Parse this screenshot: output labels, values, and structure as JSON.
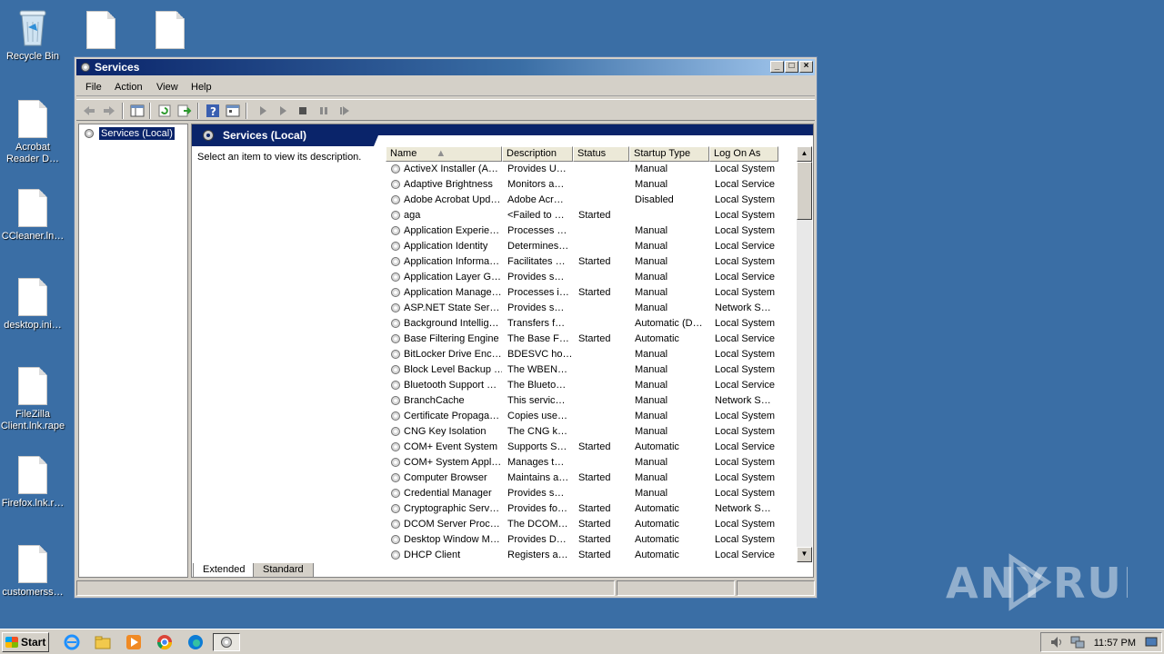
{
  "desktop": {
    "icons": [
      {
        "label": "Recycle Bin"
      },
      {
        "label": "Acrobat Reader D…"
      },
      {
        "label": "CCleaner.ln…"
      },
      {
        "label": "desktop.ini…"
      },
      {
        "label": "FileZilla Client.lnk.rape"
      },
      {
        "label": "Firefox.lnk.r…"
      },
      {
        "label": "customerss…"
      }
    ]
  },
  "window": {
    "title": "Services",
    "menu": [
      "File",
      "Action",
      "View",
      "Help"
    ],
    "tree": {
      "selected": "Services (Local)"
    },
    "header": {
      "title": "Services (Local)"
    },
    "description_hint": "Select an item to view its description.",
    "columns": [
      "Name",
      "Description",
      "Status",
      "Startup Type",
      "Log On As"
    ],
    "rows": [
      {
        "name": "ActiveX Installer (A…",
        "desc": "Provides U…",
        "status": "",
        "startup": "Manual",
        "logon": "Local System"
      },
      {
        "name": "Adaptive Brightness",
        "desc": "Monitors a…",
        "status": "",
        "startup": "Manual",
        "logon": "Local Service"
      },
      {
        "name": "Adobe Acrobat Upd…",
        "desc": "Adobe Acr…",
        "status": "",
        "startup": "Disabled",
        "logon": "Local System"
      },
      {
        "name": "aga",
        "desc": "<Failed to …",
        "status": "Started",
        "startup": "",
        "logon": "Local System"
      },
      {
        "name": "Application Experie…",
        "desc": "Processes …",
        "status": "",
        "startup": "Manual",
        "logon": "Local System"
      },
      {
        "name": "Application Identity",
        "desc": "Determines…",
        "status": "",
        "startup": "Manual",
        "logon": "Local Service"
      },
      {
        "name": "Application Informa…",
        "desc": "Facilitates …",
        "status": "Started",
        "startup": "Manual",
        "logon": "Local System"
      },
      {
        "name": "Application Layer G…",
        "desc": "Provides s…",
        "status": "",
        "startup": "Manual",
        "logon": "Local Service"
      },
      {
        "name": "Application Manage…",
        "desc": "Processes i…",
        "status": "Started",
        "startup": "Manual",
        "logon": "Local System"
      },
      {
        "name": "ASP.NET State Ser…",
        "desc": "Provides s…",
        "status": "",
        "startup": "Manual",
        "logon": "Network S…"
      },
      {
        "name": "Background Intellig…",
        "desc": "Transfers f…",
        "status": "",
        "startup": "Automatic (D…",
        "logon": "Local System"
      },
      {
        "name": "Base Filtering Engine",
        "desc": "The Base F…",
        "status": "Started",
        "startup": "Automatic",
        "logon": "Local Service"
      },
      {
        "name": "BitLocker Drive Enc…",
        "desc": "BDESVC ho…",
        "status": "",
        "startup": "Manual",
        "logon": "Local System"
      },
      {
        "name": "Block Level Backup …",
        "desc": "The WBEN…",
        "status": "",
        "startup": "Manual",
        "logon": "Local System"
      },
      {
        "name": "Bluetooth Support …",
        "desc": "The Blueto…",
        "status": "",
        "startup": "Manual",
        "logon": "Local Service"
      },
      {
        "name": "BranchCache",
        "desc": "This servic…",
        "status": "",
        "startup": "Manual",
        "logon": "Network S…"
      },
      {
        "name": "Certificate Propaga…",
        "desc": "Copies use…",
        "status": "",
        "startup": "Manual",
        "logon": "Local System"
      },
      {
        "name": "CNG Key Isolation",
        "desc": "The CNG k…",
        "status": "",
        "startup": "Manual",
        "logon": "Local System"
      },
      {
        "name": "COM+ Event System",
        "desc": "Supports S…",
        "status": "Started",
        "startup": "Automatic",
        "logon": "Local Service"
      },
      {
        "name": "COM+ System Appl…",
        "desc": "Manages t…",
        "status": "",
        "startup": "Manual",
        "logon": "Local System"
      },
      {
        "name": "Computer Browser",
        "desc": "Maintains a…",
        "status": "Started",
        "startup": "Manual",
        "logon": "Local System"
      },
      {
        "name": "Credential Manager",
        "desc": "Provides s…",
        "status": "",
        "startup": "Manual",
        "logon": "Local System"
      },
      {
        "name": "Cryptographic Serv…",
        "desc": "Provides fo…",
        "status": "Started",
        "startup": "Automatic",
        "logon": "Network S…"
      },
      {
        "name": "DCOM Server Proc…",
        "desc": "The DCOM…",
        "status": "Started",
        "startup": "Automatic",
        "logon": "Local System"
      },
      {
        "name": "Desktop Window M…",
        "desc": "Provides D…",
        "status": "Started",
        "startup": "Automatic",
        "logon": "Local System"
      },
      {
        "name": "DHCP Client",
        "desc": "Registers a…",
        "status": "Started",
        "startup": "Automatic",
        "logon": "Local Service"
      }
    ],
    "tabs": [
      "Extended",
      "Standard"
    ]
  },
  "taskbar": {
    "start_label": "Start",
    "clock": "11:57 PM"
  },
  "watermark": "ANY RUN",
  "colors": {
    "desktop": "#3a6ea5",
    "title_active": "#0a246a",
    "chrome": "#d4d0c8"
  }
}
